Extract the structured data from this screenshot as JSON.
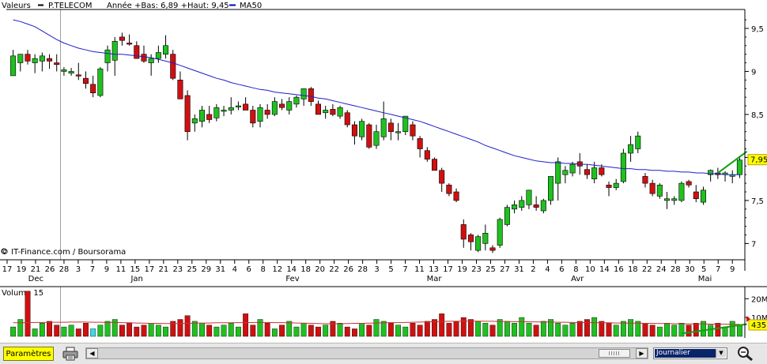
{
  "chart_data": [
    {
      "type": "candlestick",
      "legend": [
        {
          "label": "Valeurs",
          "color": ""
        },
        {
          "label": "P.TELECOM",
          "color": "#000000"
        },
        {
          "label": "Année +Bas: 6,89 +Haut: 9,45",
          "color": ""
        },
        {
          "label": "MA50",
          "color": "#0000c0"
        }
      ],
      "y_ticks": [
        "9,5",
        "9",
        "8,5",
        "8",
        "7,5",
        "7"
      ],
      "ylim": [
        6.82,
        9.72
      ],
      "last_price_label": "7,95",
      "source_note": "© IT-Finance.com / Boursorama",
      "x_day_ticks": [
        "17",
        "19",
        "21",
        "26",
        "28",
        "3",
        "7",
        "9",
        "11",
        "15",
        "17",
        "21",
        "23",
        "25",
        "29",
        "31",
        "4",
        "6",
        "8",
        "12",
        "14",
        "18",
        "20",
        "22",
        "26",
        "28",
        "3",
        "5",
        "7",
        "11",
        "13",
        "17",
        "19",
        "23",
        "25",
        "27",
        "31",
        "2",
        "4",
        "6",
        "8",
        "10",
        "14",
        "16",
        "18",
        "22",
        "24",
        "28",
        "30",
        "5",
        "7",
        "9"
      ],
      "x_month_labels": [
        "Dec",
        "Jan",
        "Fev",
        "Mar",
        "Avr",
        "Mai"
      ],
      "colors": {
        "up": "#20c020",
        "down": "#d01010",
        "ma": "#1e1ec8",
        "trend": "#10a010",
        "axis": "#000000"
      },
      "candles": [
        [
          8.95,
          9.25,
          9.1,
          9.18
        ],
        [
          9.1,
          9.2,
          9.0,
          9.2
        ],
        [
          9.2,
          9.25,
          9.08,
          9.12
        ],
        [
          9.1,
          9.2,
          8.98,
          9.15
        ],
        [
          9.12,
          9.22,
          9.0,
          9.18
        ],
        [
          9.15,
          9.2,
          9.03,
          9.12
        ],
        [
          9.1,
          9.2,
          9.0,
          9.08
        ],
        [
          9.0,
          9.05,
          8.95,
          9.02
        ],
        [
          8.98,
          9.04,
          8.95,
          9.0
        ],
        [
          8.96,
          9.1,
          8.9,
          8.95
        ],
        [
          8.92,
          9.0,
          8.8,
          8.86
        ],
        [
          8.85,
          8.95,
          8.7,
          8.75
        ],
        [
          8.72,
          9.05,
          8.7,
          9.03
        ],
        [
          9.1,
          9.3,
          9.0,
          9.25
        ],
        [
          9.13,
          9.4,
          8.95,
          9.35
        ],
        [
          9.4,
          9.45,
          9.3,
          9.36
        ],
        [
          9.33,
          9.43,
          9.3,
          9.32
        ],
        [
          9.3,
          9.35,
          9.15,
          9.15
        ],
        [
          9.2,
          9.3,
          9.1,
          9.12
        ],
        [
          9.1,
          9.2,
          8.95,
          9.15
        ],
        [
          9.15,
          9.3,
          9.1,
          9.22
        ],
        [
          9.2,
          9.42,
          9.15,
          9.3
        ],
        [
          9.2,
          9.25,
          8.9,
          8.92
        ],
        [
          8.9,
          9.0,
          8.7,
          8.68
        ],
        [
          8.72,
          8.78,
          8.2,
          8.3
        ],
        [
          8.4,
          8.5,
          8.3,
          8.45
        ],
        [
          8.42,
          8.6,
          8.35,
          8.55
        ],
        [
          8.5,
          8.6,
          8.4,
          8.44
        ],
        [
          8.46,
          8.62,
          8.42,
          8.58
        ],
        [
          8.55,
          8.6,
          8.48,
          8.55
        ],
        [
          8.55,
          8.7,
          8.5,
          8.58
        ],
        [
          8.6,
          8.65,
          8.55,
          8.6
        ],
        [
          8.62,
          8.7,
          8.55,
          8.55
        ],
        [
          8.55,
          8.6,
          8.35,
          8.4
        ],
        [
          8.42,
          8.62,
          8.35,
          8.58
        ],
        [
          8.55,
          8.62,
          8.45,
          8.5
        ],
        [
          8.5,
          8.7,
          8.48,
          8.65
        ],
        [
          8.62,
          8.68,
          8.55,
          8.58
        ],
        [
          8.55,
          8.7,
          8.5,
          8.65
        ],
        [
          8.62,
          8.72,
          8.58,
          8.7
        ],
        [
          8.68,
          8.8,
          8.6,
          8.8
        ],
        [
          8.8,
          8.82,
          8.6,
          8.65
        ],
        [
          8.62,
          8.66,
          8.5,
          8.5
        ],
        [
          8.52,
          8.6,
          8.45,
          8.55
        ],
        [
          8.56,
          8.62,
          8.48,
          8.5
        ],
        [
          8.48,
          8.6,
          8.45,
          8.58
        ],
        [
          8.52,
          8.55,
          8.35,
          8.38
        ],
        [
          8.38,
          8.42,
          8.15,
          8.25
        ],
        [
          8.24,
          8.45,
          8.2,
          8.42
        ],
        [
          8.38,
          8.4,
          8.1,
          8.12
        ],
        [
          8.14,
          8.38,
          8.1,
          8.3
        ],
        [
          8.24,
          8.65,
          8.2,
          8.45
        ],
        [
          8.4,
          8.45,
          8.2,
          8.3
        ],
        [
          8.3,
          8.4,
          8.2,
          8.3
        ],
        [
          8.3,
          8.48,
          8.26,
          8.48
        ],
        [
          8.38,
          8.42,
          8.2,
          8.25
        ],
        [
          8.22,
          8.25,
          8.0,
          8.1
        ],
        [
          8.08,
          8.12,
          7.95,
          7.98
        ],
        [
          7.98,
          8.0,
          7.85,
          7.85
        ],
        [
          7.85,
          7.88,
          7.6,
          7.7
        ],
        [
          7.68,
          7.7,
          7.55,
          7.58
        ],
        [
          7.6,
          7.64,
          7.48,
          7.5
        ],
        [
          7.22,
          7.28,
          6.95,
          7.05
        ],
        [
          7.1,
          7.12,
          6.92,
          7.02
        ],
        [
          6.92,
          7.1,
          6.9,
          7.08
        ],
        [
          7.0,
          7.22,
          6.92,
          7.12
        ],
        [
          6.95,
          6.98,
          6.89,
          6.92
        ],
        [
          6.98,
          7.3,
          6.95,
          7.28
        ],
        [
          7.22,
          7.45,
          7.2,
          7.42
        ],
        [
          7.4,
          7.5,
          7.35,
          7.45
        ],
        [
          7.42,
          7.55,
          7.38,
          7.5
        ],
        [
          7.45,
          7.62,
          7.4,
          7.62
        ],
        [
          7.45,
          7.55,
          7.38,
          7.42
        ],
        [
          7.38,
          7.52,
          7.35,
          7.5
        ],
        [
          7.5,
          7.78,
          7.45,
          7.78
        ],
        [
          7.7,
          8.0,
          7.5,
          7.95
        ],
        [
          7.8,
          7.9,
          7.7,
          7.85
        ],
        [
          7.82,
          7.95,
          7.78,
          7.92
        ],
        [
          7.95,
          8.05,
          7.8,
          7.9
        ],
        [
          7.86,
          7.92,
          7.75,
          7.8
        ],
        [
          7.75,
          7.95,
          7.7,
          7.88
        ],
        [
          7.88,
          7.92,
          7.78,
          7.8
        ],
        [
          7.68,
          7.72,
          7.55,
          7.65
        ],
        [
          7.65,
          7.75,
          7.62,
          7.7
        ],
        [
          7.72,
          8.1,
          7.7,
          8.05
        ],
        [
          8.05,
          8.25,
          7.95,
          8.15
        ],
        [
          8.1,
          8.3,
          8.05,
          8.25
        ],
        [
          7.78,
          7.82,
          7.65,
          7.7
        ],
        [
          7.7,
          7.74,
          7.55,
          7.58
        ],
        [
          7.55,
          7.7,
          7.52,
          7.68
        ],
        [
          7.5,
          7.6,
          7.4,
          7.52
        ],
        [
          7.5,
          7.55,
          7.45,
          7.52
        ],
        [
          7.5,
          7.72,
          7.48,
          7.7
        ],
        [
          7.72,
          7.74,
          7.65,
          7.68
        ],
        [
          7.6,
          7.68,
          7.48,
          7.52
        ],
        [
          7.48,
          7.66,
          7.45,
          7.62
        ],
        [
          7.8,
          7.86,
          7.72,
          7.85
        ],
        [
          7.82,
          7.88,
          7.75,
          7.8
        ],
        [
          7.8,
          7.84,
          7.72,
          7.82
        ],
        [
          7.78,
          7.85,
          7.7,
          7.8
        ],
        [
          7.8,
          8.0,
          7.76,
          7.97
        ]
      ],
      "ma50": [
        9.6,
        9.58,
        9.55,
        9.52,
        9.47,
        9.42,
        9.37,
        9.33,
        9.3,
        9.27,
        9.25,
        9.23,
        9.22,
        9.21,
        9.2,
        9.2,
        9.19,
        9.18,
        9.17,
        9.16,
        9.14,
        9.12,
        9.1,
        9.07,
        9.04,
        9.01,
        8.98,
        8.95,
        8.92,
        8.9,
        8.87,
        8.85,
        8.83,
        8.81,
        8.79,
        8.78,
        8.76,
        8.75,
        8.74,
        8.73,
        8.72,
        8.71,
        8.69,
        8.68,
        8.66,
        8.64,
        8.62,
        8.6,
        8.58,
        8.56,
        8.54,
        8.52,
        8.5,
        8.48,
        8.46,
        8.44,
        8.42,
        8.39,
        8.36,
        8.33,
        8.3,
        8.27,
        8.24,
        8.21,
        8.18,
        8.14,
        8.11,
        8.08,
        8.05,
        8.02,
        8.0,
        7.98,
        7.96,
        7.95,
        7.94,
        7.94,
        7.93,
        7.93,
        7.92,
        7.92,
        7.91,
        7.9,
        7.89,
        7.88,
        7.87,
        7.87,
        7.86,
        7.86,
        7.85,
        7.85,
        7.84,
        7.84,
        7.83,
        7.83,
        7.82,
        7.82,
        7.81,
        7.81,
        7.8,
        7.8,
        7.8
      ],
      "trendline": {
        "start": [
          97,
          7.82
        ],
        "end": [
          101,
          8.07
        ]
      }
    },
    {
      "type": "bar",
      "title": "Volume 15",
      "y_ticks": [
        "20M",
        "10M"
      ],
      "ylim": [
        0,
        26
      ],
      "last_value_label": "435",
      "colors": {
        "up": "#20c020",
        "down": "#d01010",
        "highlight": "#40d8e8",
        "ma": "#c83232",
        "trend": "#10a010"
      },
      "highlight_index": 11,
      "values": [
        5,
        9,
        24,
        4,
        7,
        8,
        6,
        5,
        6,
        4,
        7,
        4,
        6,
        8,
        9,
        6,
        7,
        5,
        6,
        7,
        6,
        5,
        8,
        9,
        11,
        8,
        7,
        6,
        5,
        6,
        7,
        5,
        12,
        6,
        9,
        7,
        4,
        6,
        8,
        5,
        7,
        6,
        5,
        6,
        8,
        7,
        5,
        4,
        7,
        6,
        9,
        8,
        7,
        6,
        5,
        7,
        6,
        8,
        9,
        12,
        7,
        8,
        10,
        9,
        8,
        7,
        6,
        9,
        8,
        7,
        10,
        7,
        6,
        8,
        9,
        7,
        6,
        7,
        8,
        9,
        10,
        8,
        7,
        6,
        8,
        9,
        8,
        7,
        6,
        5,
        7,
        6,
        7,
        6,
        7,
        8,
        6,
        7,
        5,
        8,
        6
      ],
      "ma15": [
        7.2,
        7.2,
        7.3,
        7.4,
        7.4,
        7.5,
        7.5,
        7.5,
        7.6,
        7.6,
        7.6,
        7.5,
        7.5,
        7.4,
        7.4,
        7.3,
        7.2,
        7.1,
        7.0,
        6.9,
        6.9,
        6.8,
        6.8,
        6.8,
        6.9,
        7.0,
        7.1,
        7.1,
        7.2,
        7.2,
        7.2,
        7.3,
        7.3,
        7.4,
        7.4,
        7.4,
        7.3,
        7.3,
        7.2,
        7.1,
        7.0,
        6.9,
        6.8,
        6.7,
        6.7,
        6.7,
        6.8,
        6.9,
        6.9,
        7.0,
        7.1,
        7.2,
        7.3,
        7.3,
        7.4,
        7.5,
        7.6,
        7.7,
        7.8,
        7.9,
        8.0,
        8.0,
        8.1,
        8.1,
        8.1,
        8.0,
        8.0,
        7.9,
        7.9,
        7.8,
        7.8,
        7.7,
        7.7,
        7.6,
        7.6,
        7.5,
        7.5,
        7.4,
        7.4,
        7.3,
        7.3,
        7.2,
        7.2,
        7.1,
        7.1,
        7.0,
        7.0,
        6.9,
        6.9,
        6.8,
        6.8,
        6.7,
        6.7,
        6.6,
        6.6,
        6.6,
        6.5,
        6.5,
        6.5,
        6.4,
        6.4
      ],
      "trendline": {
        "start": [
          92,
          1.5
        ],
        "end": [
          101,
          6.5
        ]
      }
    }
  ],
  "controls": {
    "params_label": "Paramètres",
    "period_value": "Journalier"
  }
}
